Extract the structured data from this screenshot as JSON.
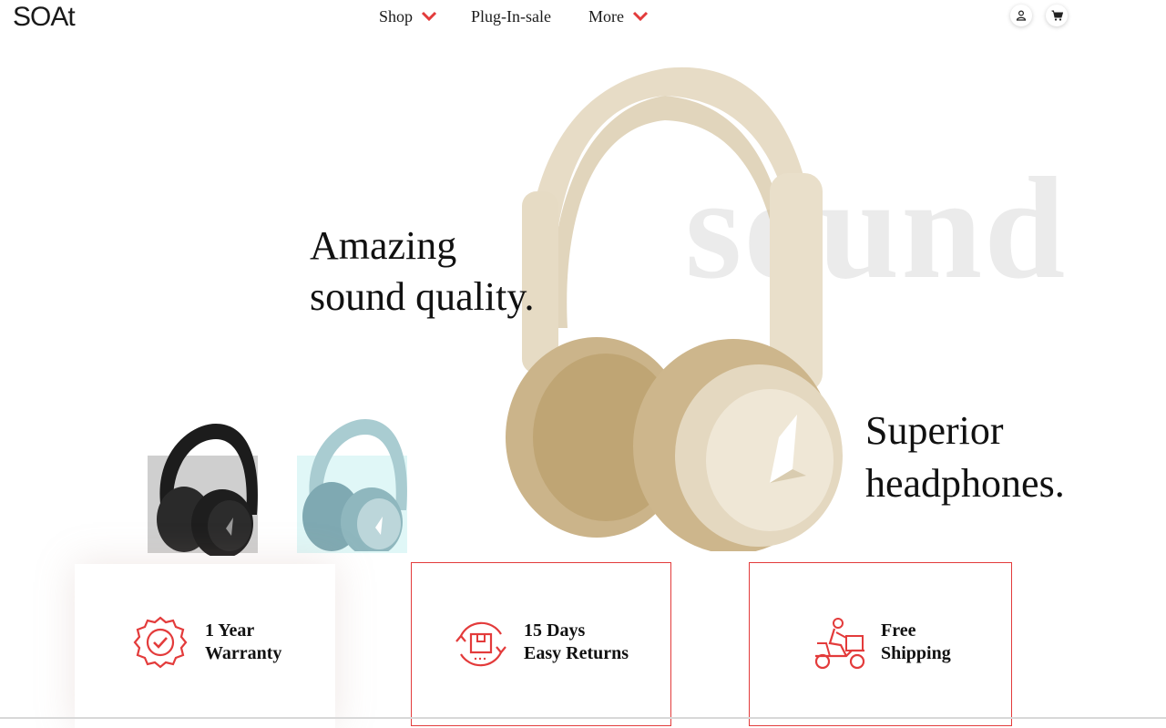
{
  "header": {
    "logo_text": "SOAt",
    "nav": [
      {
        "label": "Shop",
        "has_dropdown": true
      },
      {
        "label": "Plug-In-sale",
        "has_dropdown": false
      },
      {
        "label": "More",
        "has_dropdown": true
      }
    ],
    "icons": [
      "user-icon",
      "cart-icon"
    ]
  },
  "hero": {
    "background_word": "sound",
    "headline_left_line1": "Amazing",
    "headline_left_line2": "sound quality.",
    "headline_right_line1": "Superior",
    "headline_right_line2": "headphones.",
    "variants": [
      {
        "name": "black-headphones",
        "swatch": "#cfcfcf"
      },
      {
        "name": "blue-headphones",
        "swatch": "#e0f7f7"
      }
    ]
  },
  "features": [
    {
      "line1": "1 Year",
      "line2": "Warranty",
      "icon": "warranty-badge-icon"
    },
    {
      "line1": "15 Days",
      "line2": "Easy Returns",
      "icon": "returns-box-icon"
    },
    {
      "line1": "Free",
      "line2": "Shipping",
      "icon": "delivery-scooter-icon"
    }
  ],
  "colors": {
    "accent": "#e33b3b",
    "headphone_main": "#e4d7bd",
    "background_word": "#ebebeb"
  }
}
